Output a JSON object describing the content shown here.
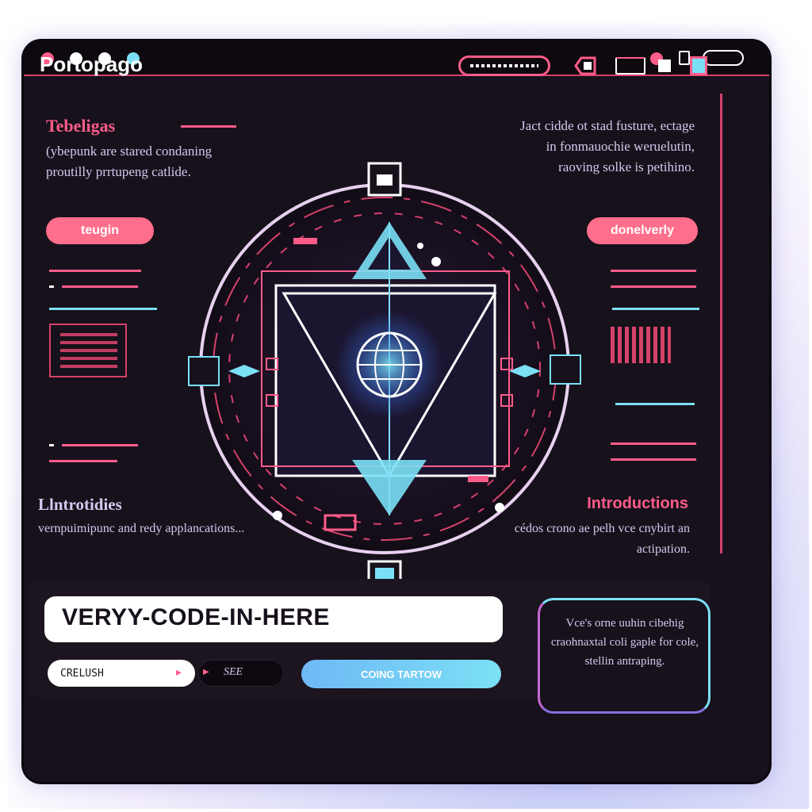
{
  "window": {
    "app_name": "Portopago"
  },
  "left_top": {
    "title": "Tebeligas",
    "body": "(ybepunk are stared condaning proutilly prrtupeng catlide.",
    "button": "teugin"
  },
  "right_top": {
    "body": "Jact cidde ot stad fusture, ectage in fonmauochie weruelutin, raoving solke is petihino.",
    "button": "donelverly"
  },
  "left_bottom": {
    "title": "Llntrotidies",
    "body": "vernpuimipunc and redy applancations..."
  },
  "right_bottom": {
    "title": "Introductions",
    "body": "cédos crono ae pelh vce cnybirt an actipation."
  },
  "footer": {
    "code_text": "VERYY-CODE-IN-HERE",
    "input_value": "CRELUSH",
    "mini_label": "SEE",
    "action_button": "COING TARTOW",
    "note": "Vce's orne uuhin cibehig craohnaxtal coli gaple for cole, stellin antraping."
  },
  "colors": {
    "accent_pink": "#ff5c8a",
    "accent_cyan": "#7be0f5",
    "background": "#17111b",
    "text_lavender": "#d7c8f0"
  },
  "icons": [
    "window-dot-icon",
    "minimize-icon",
    "maximize-icon",
    "close-icon",
    "tag-icon",
    "monitor-icon",
    "square-icon",
    "cyan-square-icon",
    "globe-icon",
    "triangle-emblem-icon"
  ]
}
